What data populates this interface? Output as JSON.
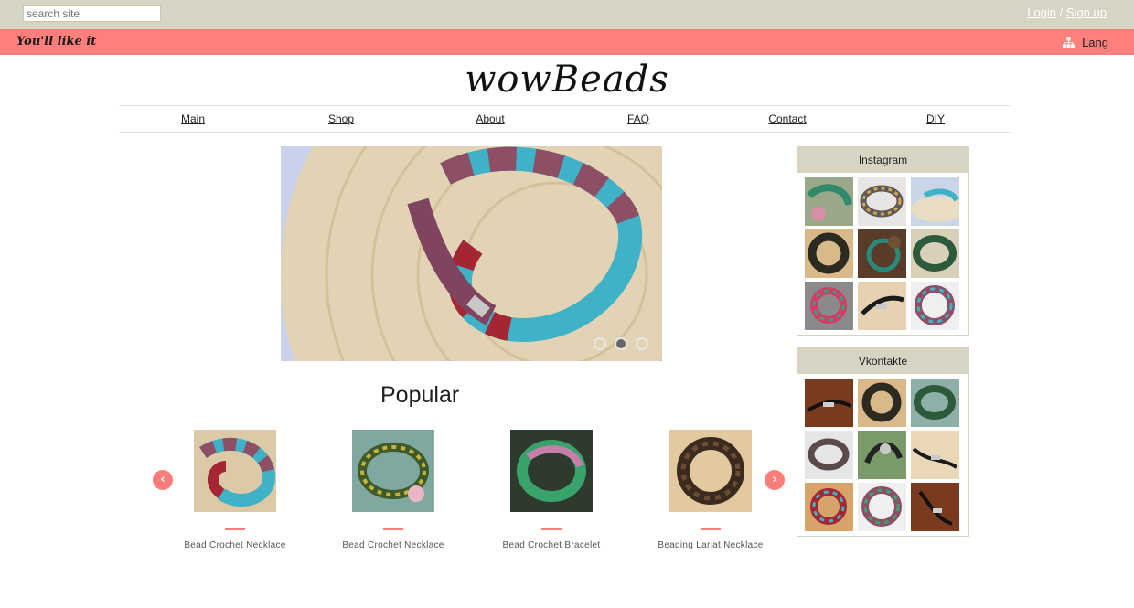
{
  "search": {
    "placeholder": "search site"
  },
  "auth": {
    "login": "Login",
    "separator": "/",
    "signup": "Sign up"
  },
  "tagline": "You'll like it",
  "lang": {
    "label": "Lang",
    "icon": "sitemap-icon"
  },
  "logo": "wowBeads",
  "nav": [
    "Main",
    "Shop",
    "About",
    "FAQ",
    "Contact",
    "DIY"
  ],
  "slider": {
    "dots": 3,
    "active": 1
  },
  "popular": {
    "title": "Popular",
    "prev_icon": "chevron-left-icon",
    "next_icon": "chevron-right-icon",
    "items": [
      {
        "name": "Bead Crochet Necklace"
      },
      {
        "name": "Bead Crochet Necklace"
      },
      {
        "name": "Bead Crochet Bracelet"
      },
      {
        "name": "Beading Lariat Necklace"
      }
    ]
  },
  "instagram": {
    "title": "Instagram"
  },
  "vkontakte": {
    "title": "Vkontakte"
  },
  "colors": {
    "topbar": "#d8d4c3",
    "accent": "#fe7f7b",
    "panel_head": "#d8d4c3"
  }
}
